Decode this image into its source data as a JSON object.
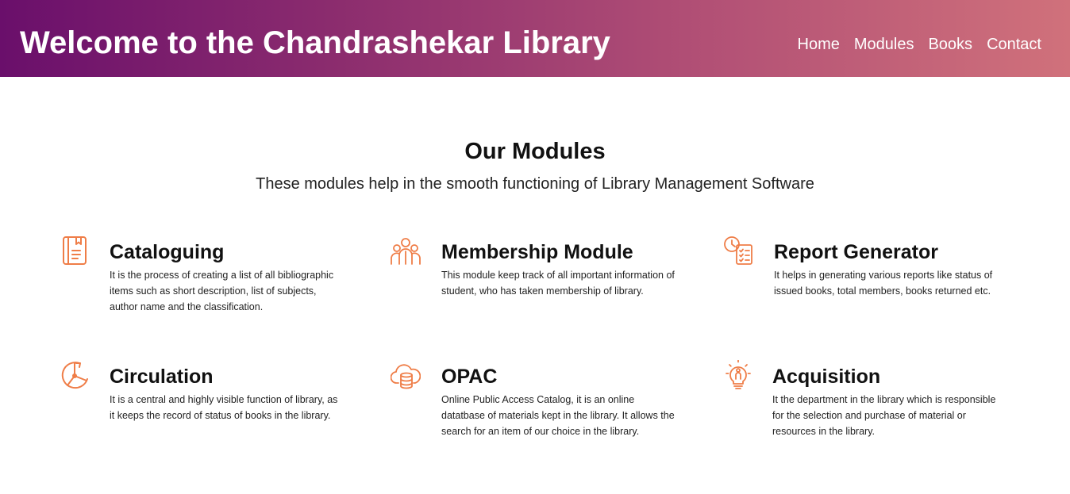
{
  "header": {
    "title": "Welcome to the Chandrashekar Library",
    "nav": [
      "Home",
      "Modules",
      "Books",
      "Contact"
    ]
  },
  "section": {
    "title": "Our Modules",
    "subtitle": "These modules help in the smooth functioning of Library Management Software"
  },
  "modules": [
    {
      "icon": "book-icon",
      "title": "Cataloguing",
      "description": "It is the process of creating a list of all bibliographic items such as short description, list of subjects, author name and the classification."
    },
    {
      "icon": "people-icon",
      "title": "Membership Module",
      "description": "This module keep track of all important information of student, who has taken membership of library."
    },
    {
      "icon": "report-clock-icon",
      "title": "Report Generator",
      "description": "It helps in generating various reports like status of issued books, total members, books returned etc."
    },
    {
      "icon": "pie-refresh-icon",
      "title": "Circulation",
      "description": "It is a central and highly visible function of library, as it keeps the record of status of books in the library."
    },
    {
      "icon": "cloud-database-icon",
      "title": "OPAC",
      "description": "Online Public Access Catalog, it is an online datatbase of materials kept in the library. It allows the search for an item of our choice in the library."
    },
    {
      "icon": "lightbulb-person-icon",
      "title": "Acquisition",
      "description": "It the department in the library which is responsible for the selection and purchase of material or resources in the library."
    }
  ],
  "colors": {
    "header_gradient_start": "#6a0f6b",
    "header_gradient_end": "#d0717b",
    "icon_accent": "#ef7d47"
  }
}
